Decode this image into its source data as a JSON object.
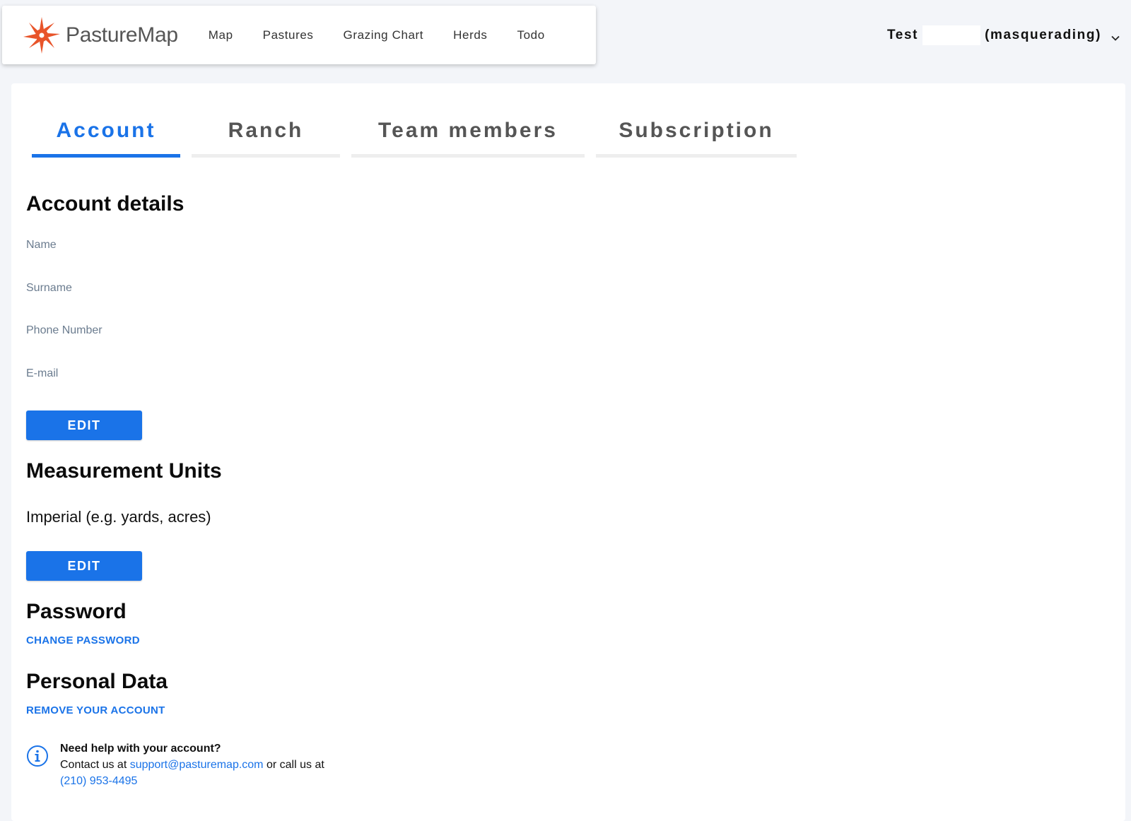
{
  "nav": {
    "brand": "PastureMap",
    "links": [
      "Map",
      "Pastures",
      "Grazing Chart",
      "Herds",
      "Todo"
    ]
  },
  "user": {
    "first": "Test",
    "suffix": "(masquerading)"
  },
  "tabs": [
    "Account",
    "Ranch",
    "Team members",
    "Subscription"
  ],
  "account": {
    "title": "Account details",
    "fields": [
      "Name",
      "Surname",
      "Phone Number",
      "E-mail"
    ],
    "edit_label": "EDIT"
  },
  "units": {
    "title": "Measurement Units",
    "value": "Imperial (e.g. yards, acres)",
    "edit_label": "EDIT"
  },
  "password": {
    "title": "Password",
    "action": "CHANGE PASSWORD"
  },
  "personal": {
    "title": "Personal Data",
    "action": "REMOVE YOUR ACCOUNT"
  },
  "help": {
    "title": "Need help with your account?",
    "prefix": "Contact us at",
    "email": "support@pasturemap.com",
    "middle": "or call us at",
    "phone": "(210) 953-4495"
  },
  "colors": {
    "accent": "#1a73e8",
    "logo": "#e8542a"
  }
}
